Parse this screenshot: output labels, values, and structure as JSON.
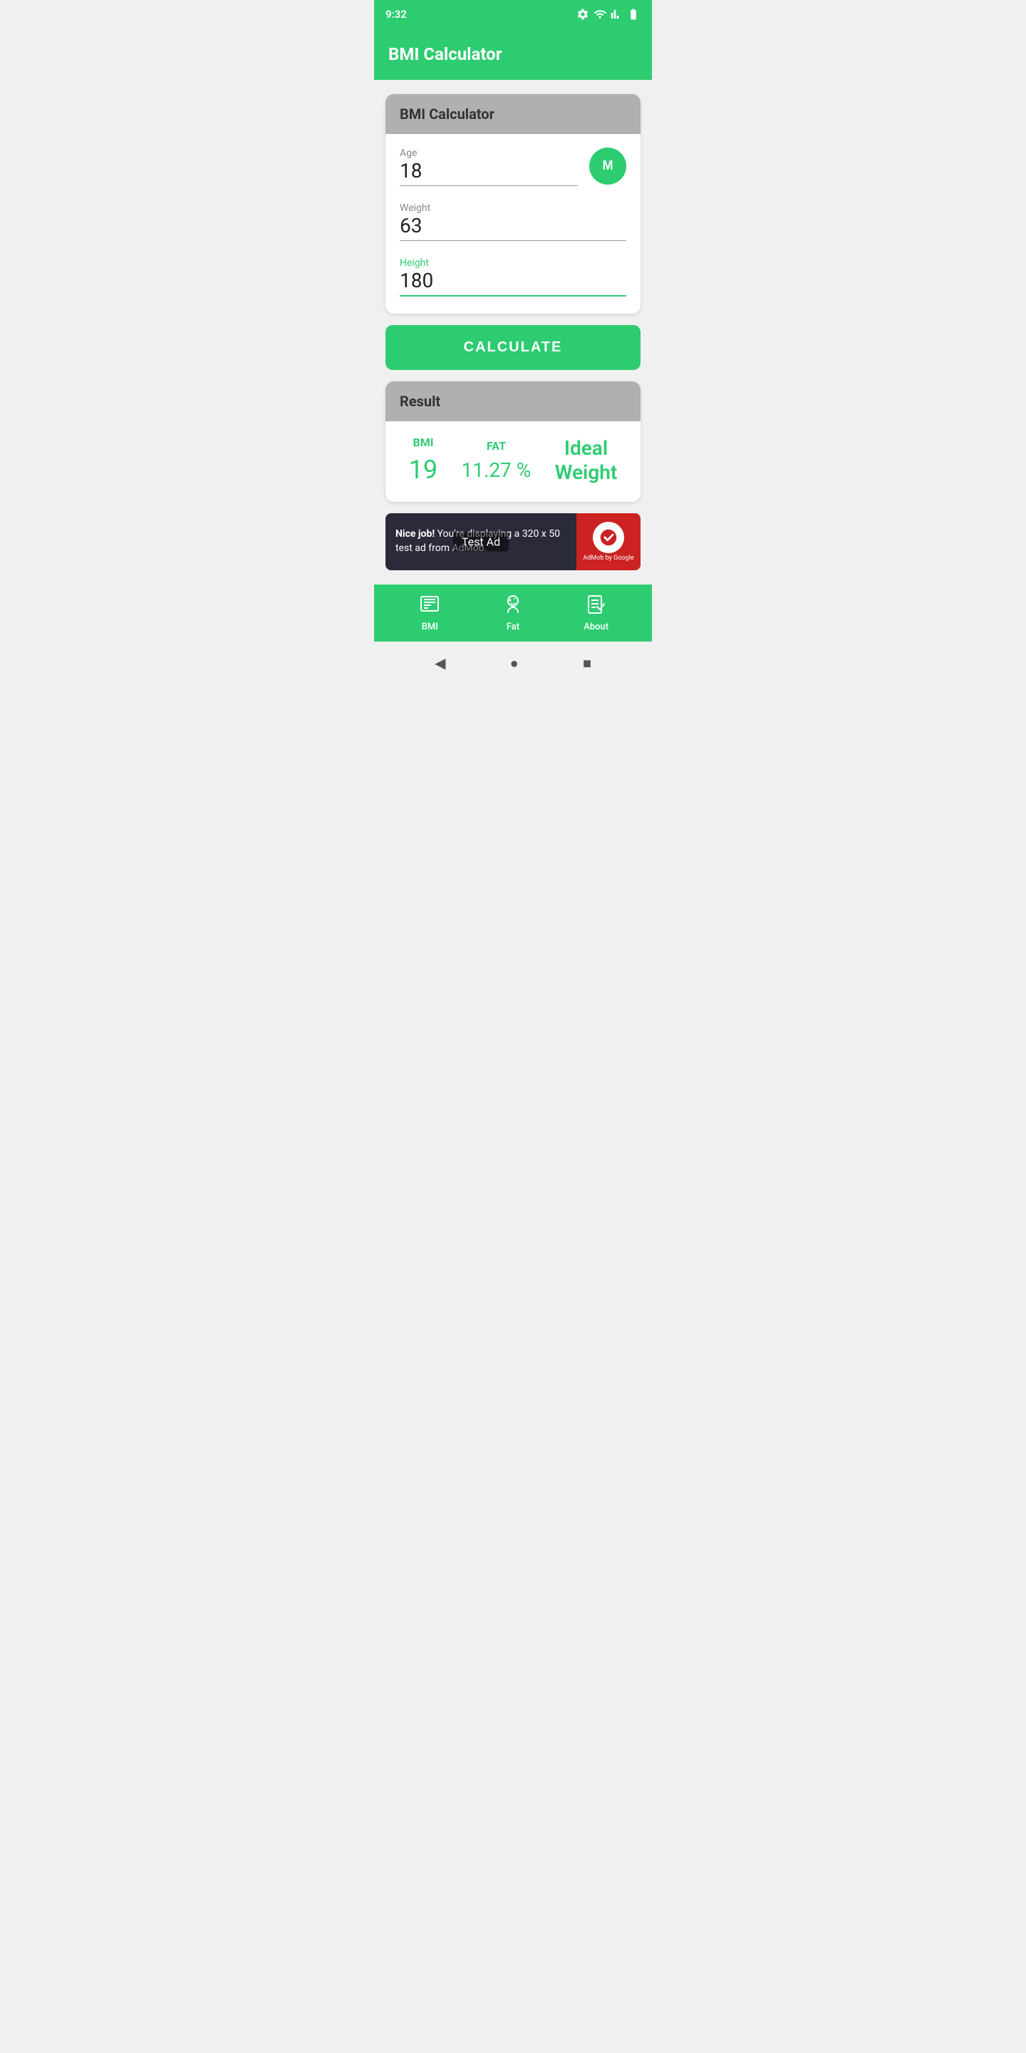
{
  "statusBar": {
    "time": "9:32",
    "wifiIcon": "wifi",
    "signalIcon": "signal",
    "batteryIcon": "battery"
  },
  "appBar": {
    "title": "BMI Calculator"
  },
  "calculatorCard": {
    "headerTitle": "BMI Calculator",
    "ageLabel": "Age",
    "ageValue": "18",
    "genderLabel": "M",
    "weightLabel": "Weight",
    "weightValue": "63",
    "heightLabel": "Height",
    "heightValue": "180"
  },
  "calculateButton": {
    "label": "CALCULATE"
  },
  "resultCard": {
    "headerTitle": "Result",
    "bmiLabel": "BMI",
    "bmiValue": "19",
    "fatLabel": "FAT",
    "fatValue": "11.27 %",
    "idealLabel": "Ideal\nWeight"
  },
  "adBanner": {
    "badgeText": "Test Ad",
    "mainText": "Nice job! You're displaying a 320 x 50 test ad from AdMob.",
    "niceJob": "Nice job!",
    "rest": " You're displaying a 320 x 50\ntest ad from AdMob.",
    "admobLabel": "AdMob by Google"
  },
  "bottomNav": {
    "items": [
      {
        "id": "bmi",
        "label": "BMI",
        "icon": "bmi"
      },
      {
        "id": "fat",
        "label": "Fat",
        "icon": "fat"
      },
      {
        "id": "about",
        "label": "About",
        "icon": "about"
      }
    ]
  },
  "sysNav": {
    "backIcon": "◀",
    "homeIcon": "●",
    "recentIcon": "■"
  }
}
